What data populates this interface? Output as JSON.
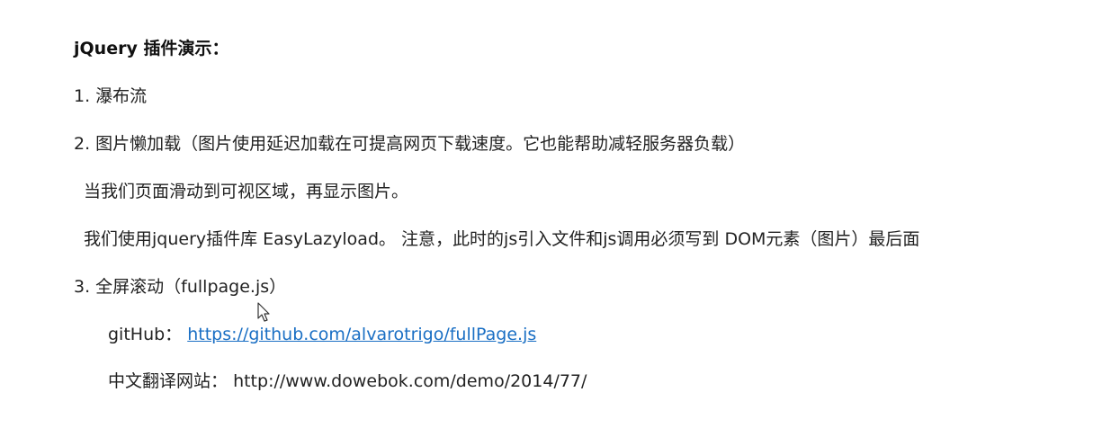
{
  "document": {
    "title": "jQuery 插件演示：",
    "items": [
      {
        "text": "1. 瀑布流"
      },
      {
        "text": "2. 图片懒加载（图片使用延迟加载在可提高网页下载速度。它也能帮助减轻服务器负载）"
      },
      {
        "text": "当我们页面滑动到可视区域，再显示图片。"
      },
      {
        "text": "我们使用jquery插件库  EasyLazyload。 注意，此时的js引入文件和js调用必须写到 DOM元素（图片）最后面"
      },
      {
        "text": "3. 全屏滚动（fullpage.js）"
      }
    ],
    "github": {
      "label": "gitHub：",
      "url": "https://github.com/alvarotrigo/fullPage.js"
    },
    "translation": {
      "label": "中文翻译网站：",
      "url": "http://www.dowebok.com/demo/2014/77/"
    }
  },
  "icons": {
    "cursor": "mouse-pointer-icon"
  }
}
